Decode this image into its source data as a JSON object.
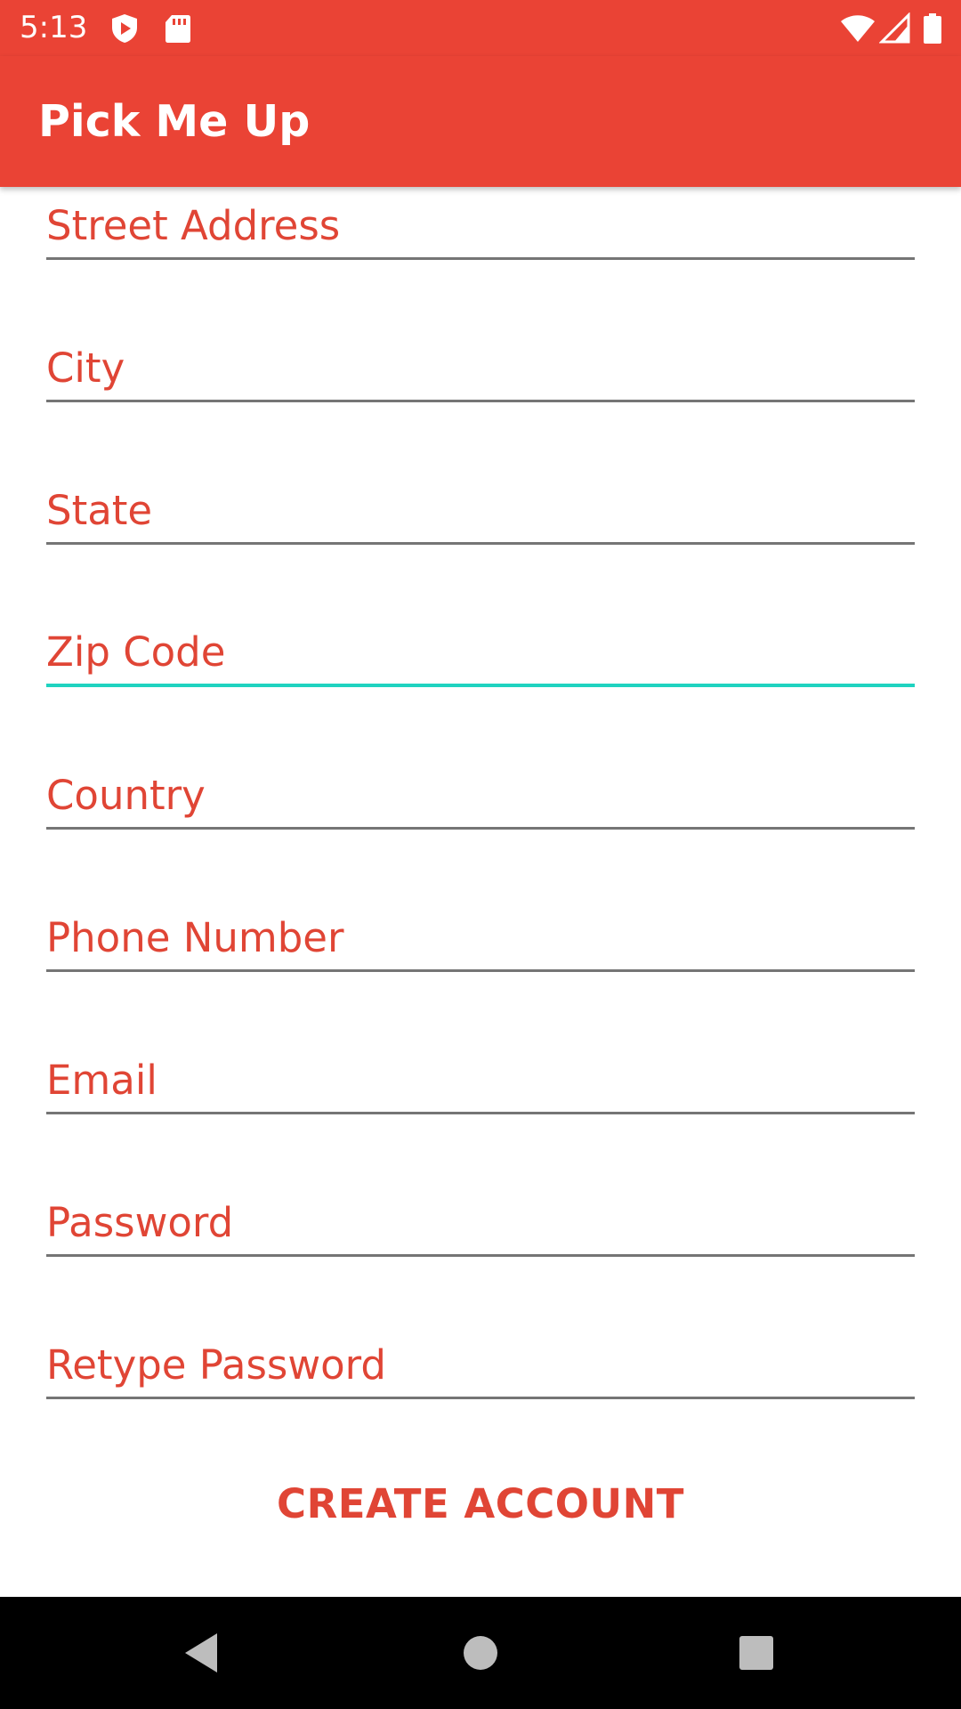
{
  "status_bar": {
    "time": "5:13",
    "icons": [
      "shield-play-icon",
      "sd-card-icon",
      "wifi-icon",
      "cell-signal-icon",
      "battery-icon"
    ]
  },
  "app_bar": {
    "title": "Pick Me Up"
  },
  "form": {
    "fields": [
      {
        "hint": "Street Address",
        "focused": false
      },
      {
        "hint": "City",
        "focused": false
      },
      {
        "hint": "State",
        "focused": false
      },
      {
        "hint": "Zip Code",
        "focused": true
      },
      {
        "hint": "Country",
        "focused": false
      },
      {
        "hint": "Phone Number",
        "focused": false
      },
      {
        "hint": "Email",
        "focused": false
      },
      {
        "hint": "Password",
        "focused": false
      },
      {
        "hint": "Retype Password",
        "focused": false
      }
    ],
    "submit_label": "CREATE ACCOUNT"
  },
  "nav_bar": {
    "buttons": [
      "back-icon",
      "home-icon",
      "recents-icon"
    ]
  },
  "colors": {
    "primary": "#EA4335",
    "hint_text": "#E04535",
    "focus_underline": "#1FD3C0",
    "underline": "#757575",
    "nav_bar": "#000000"
  }
}
